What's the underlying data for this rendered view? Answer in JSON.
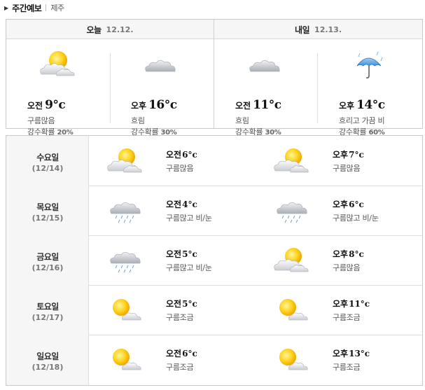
{
  "header": {
    "title": "주간예보",
    "location": "제주"
  },
  "top": {
    "today": {
      "label": "오늘",
      "date": "12.12."
    },
    "tomorrow": {
      "label": "내일",
      "date": "12.13."
    },
    "cells": [
      {
        "period": "오전",
        "temp": "9°c",
        "condition": "구름많음",
        "rain_label": "강수확률",
        "rain": "20%",
        "icon": "partly-cloudy-icon"
      },
      {
        "period": "오후",
        "temp": "16°c",
        "condition": "흐림",
        "rain_label": "강수확률",
        "rain": "30%",
        "icon": "cloudy-icon"
      },
      {
        "period": "오전",
        "temp": "11°c",
        "condition": "흐림",
        "rain_label": "강수확률",
        "rain": "30%",
        "icon": "cloudy-icon"
      },
      {
        "period": "오후",
        "temp": "14°c",
        "condition": "흐리고 가끔 비",
        "rain_label": "강수확률",
        "rain": "60%",
        "icon": "umbrella-icon"
      }
    ]
  },
  "week": [
    {
      "day": "수요일",
      "date": "(12/14)",
      "am": {
        "period": "오전",
        "temp": "6°c",
        "condition": "구름많음",
        "icon": "partly-cloudy-icon"
      },
      "pm": {
        "period": "오후",
        "temp": "7°c",
        "condition": "구름많음",
        "icon": "partly-cloudy-icon"
      }
    },
    {
      "day": "목요일",
      "date": "(12/15)",
      "am": {
        "period": "오전",
        "temp": "4°c",
        "condition": "구름많고 비/눈",
        "icon": "rain-snow-icon"
      },
      "pm": {
        "period": "오후",
        "temp": "6°c",
        "condition": "구름많고 비/눈",
        "icon": "rain-snow-icon"
      }
    },
    {
      "day": "금요일",
      "date": "(12/16)",
      "am": {
        "period": "오전",
        "temp": "5°c",
        "condition": "구름많고 비/눈",
        "icon": "rain-snow-icon"
      },
      "pm": {
        "period": "오후",
        "temp": "8°c",
        "condition": "구름많음",
        "icon": "partly-cloudy-icon"
      }
    },
    {
      "day": "토요일",
      "date": "(12/17)",
      "am": {
        "period": "오전",
        "temp": "5°c",
        "condition": "구름조금",
        "icon": "sun-cloud-small-icon"
      },
      "pm": {
        "period": "오후",
        "temp": "11°c",
        "condition": "구름조금",
        "icon": "sun-cloud-small-icon"
      }
    },
    {
      "day": "일요일",
      "date": "(12/18)",
      "am": {
        "period": "오전",
        "temp": "6°c",
        "condition": "구름조금",
        "icon": "sun-cloud-small-icon"
      },
      "pm": {
        "period": "오후",
        "temp": "13°c",
        "condition": "구름조금",
        "icon": "sun-cloud-small-icon"
      }
    }
  ]
}
